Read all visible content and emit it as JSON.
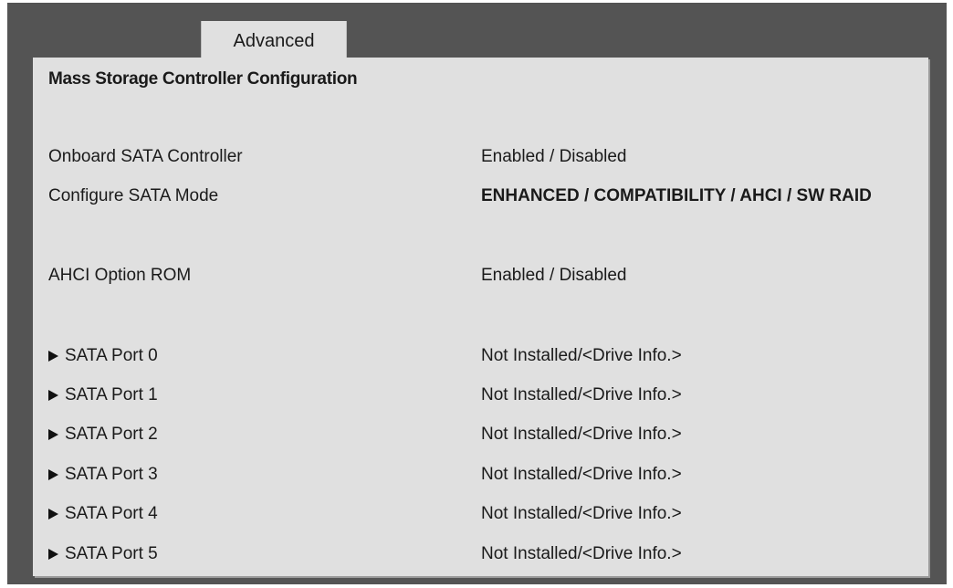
{
  "tabs": {
    "active_label": "Advanced"
  },
  "panel": {
    "title": "Mass Storage Controller Configuration"
  },
  "settings": [
    {
      "label": "Onboard SATA Controller",
      "value": "Enabled / Disabled"
    },
    {
      "label": "Configure SATA Mode",
      "value": "ENHANCED / COMPATIBILITY / AHCI / SW RAID"
    },
    {
      "label": "AHCI Option ROM",
      "value": "Enabled / Disabled"
    }
  ],
  "ports": [
    {
      "label": "SATA Port 0",
      "value": "Not Installed/<Drive Info.>"
    },
    {
      "label": "SATA Port 1",
      "value": "Not Installed/<Drive Info.>"
    },
    {
      "label": "SATA Port 2",
      "value": "Not Installed/<Drive Info.>"
    },
    {
      "label": "SATA Port 3",
      "value": "Not Installed/<Drive Info.>"
    },
    {
      "label": "SATA Port 4",
      "value": "Not Installed/<Drive Info.>"
    },
    {
      "label": "SATA Port 5",
      "value": "Not Installed/<Drive Info.>"
    }
  ],
  "icons": {
    "submenu": "triangle-right-icon"
  },
  "colors": {
    "background_frame": "#545454",
    "panel": "#e0e0e0",
    "text": "#1a1a1a"
  }
}
